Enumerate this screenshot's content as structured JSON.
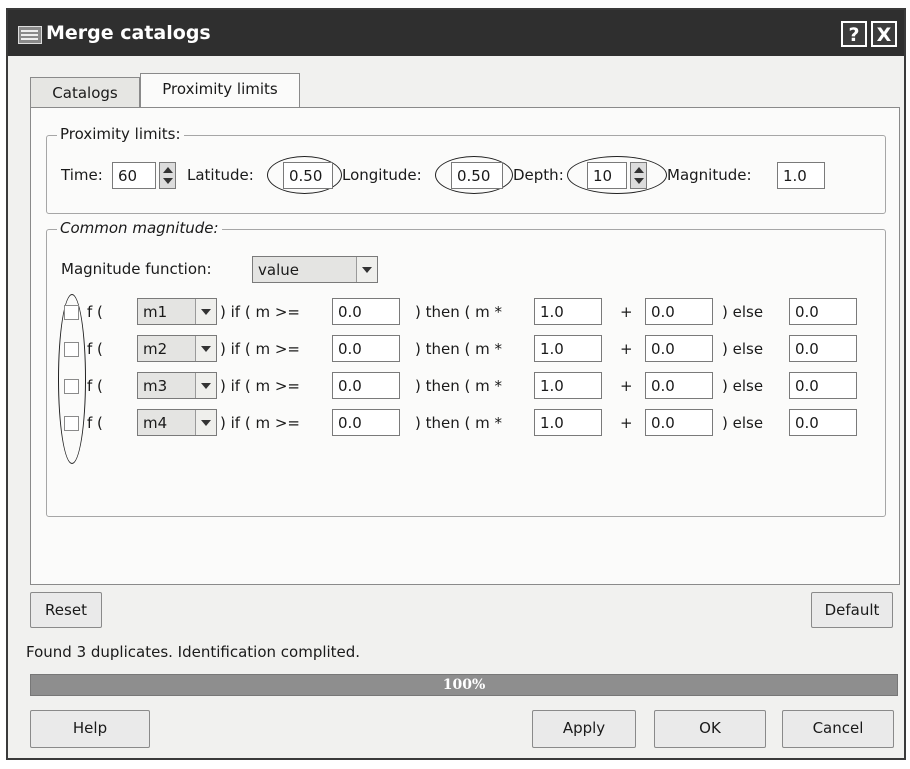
{
  "window": {
    "title": "Merge catalogs",
    "help_btn": "?",
    "close_btn": "X"
  },
  "tabs": [
    {
      "label": "Catalogs"
    },
    {
      "label": "Proximity limits"
    }
  ],
  "proximity": {
    "group_title": "Proximity limits:",
    "time_label": "Time:",
    "time_value": "60",
    "latitude_label": "Latitude:",
    "latitude_value": "0.50",
    "longitude_label": "Longitude:",
    "longitude_value": "0.50",
    "depth_label": "Depth:",
    "depth_value": "10",
    "magnitude_label": "Magnitude:",
    "magnitude_value": "1.0"
  },
  "common": {
    "group_title": "Common magnitude:",
    "function_label": "Magnitude function:",
    "function_value": "value",
    "rows": [
      {
        "f": "f (",
        "mag": "m1",
        "if": ") if ( m >=",
        "threshold": "0.0",
        "then": ") then ( m *",
        "mult": "1.0",
        "plus": "+",
        "add": "0.0",
        "else": ") else",
        "else_value": "0.0"
      },
      {
        "f": "f (",
        "mag": "m2",
        "if": ") if ( m >=",
        "threshold": "0.0",
        "then": ") then ( m *",
        "mult": "1.0",
        "plus": "+",
        "add": "0.0",
        "else": ") else",
        "else_value": "0.0"
      },
      {
        "f": "f (",
        "mag": "m3",
        "if": ") if ( m >=",
        "threshold": "0.0",
        "then": ") then ( m *",
        "mult": "1.0",
        "plus": "+",
        "add": "0.0",
        "else": ") else",
        "else_value": "0.0"
      },
      {
        "f": "f (",
        "mag": "m4",
        "if": ") if ( m >=",
        "threshold": "0.0",
        "then": ") then ( m *",
        "mult": "1.0",
        "plus": "+",
        "add": "0.0",
        "else": ") else",
        "else_value": "0.0"
      }
    ]
  },
  "buttons": {
    "reset": "Reset",
    "default": "Default",
    "help": "Help",
    "apply": "Apply",
    "ok": "OK",
    "cancel": "Cancel"
  },
  "status": "Found 3 duplicates. Identification complited.",
  "progress": {
    "percent": 100,
    "label": "100%"
  }
}
